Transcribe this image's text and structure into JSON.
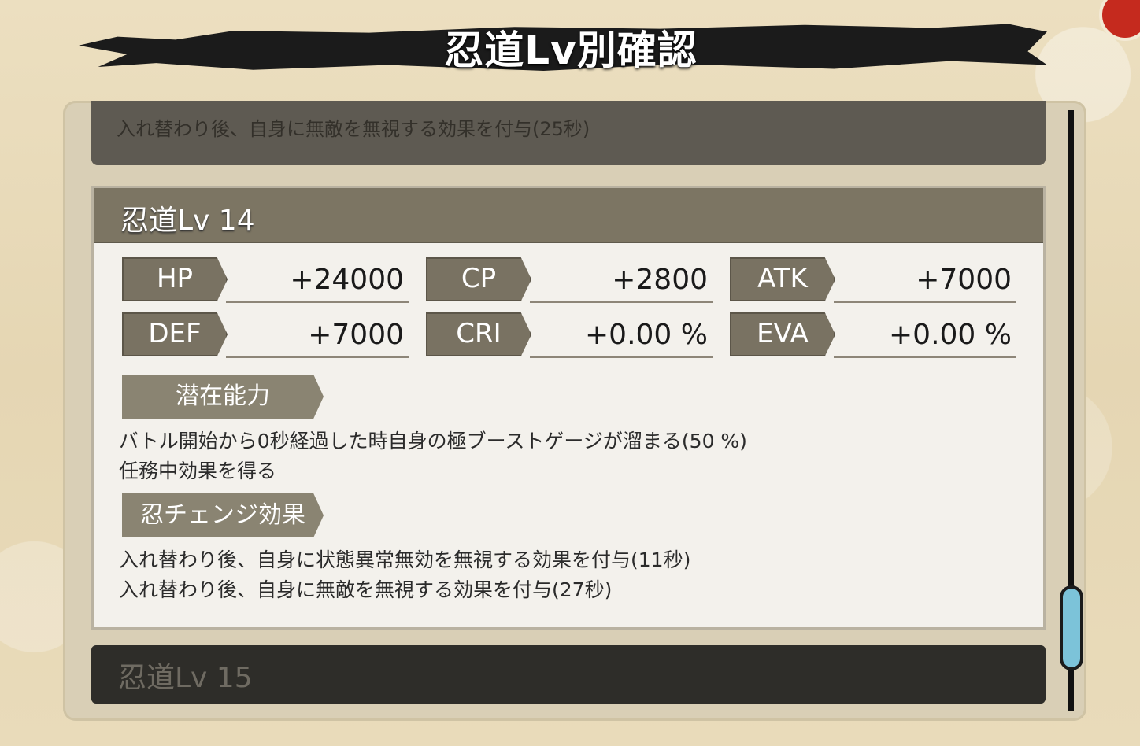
{
  "window": {
    "title": "忍道Lv別確認"
  },
  "prev_card": {
    "lines": [
      "入れ替わり後、自身に無敵を無視する効果を付与(25秒)"
    ]
  },
  "current_card": {
    "level_label": "忍道Lv 14",
    "stats": [
      {
        "name": "HP",
        "value": "+24000"
      },
      {
        "name": "CP",
        "value": "+2800"
      },
      {
        "name": "ATK",
        "value": "+7000"
      },
      {
        "name": "DEF",
        "value": "+7000"
      },
      {
        "name": "CRI",
        "value": "+0.00 %"
      },
      {
        "name": "EVA",
        "value": "+0.00 %"
      }
    ],
    "potential": {
      "label": "潜在能力",
      "lines": [
        "バトル開始から0秒経過した時自身の極ブーストゲージが溜まる(50 %)",
        "任務中効果を得る"
      ]
    },
    "change_effect": {
      "label": "忍チェンジ効果",
      "lines": [
        "入れ替わり後、自身に状態異常無効を無視する効果を付与(11秒)",
        "入れ替わり後、自身に無敵を無視する効果を付与(27秒)"
      ]
    }
  },
  "next_card": {
    "level_label": "忍道Lv 15"
  },
  "colors": {
    "background": "#e9dcbc",
    "card_header": "#7c7563",
    "stat_tag": "#797262",
    "scroll_thumb": "#7cc3d9"
  }
}
